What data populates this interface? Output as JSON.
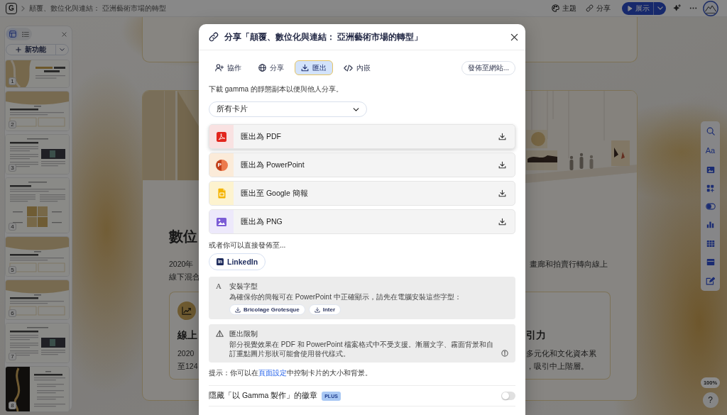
{
  "top_bar": {
    "logo": "G",
    "breadcrumb": "顛覆、數位化與連結： 亞洲藝術市場的轉型",
    "actions": [
      {
        "kind": "theme",
        "label": "主題"
      },
      {
        "kind": "share",
        "label": "分享"
      }
    ],
    "present_button": "展示"
  },
  "sidebar": {
    "view_toggle": [
      {
        "kind": "grid",
        "selected": true
      },
      {
        "kind": "list",
        "selected": false
      }
    ],
    "new_button": "新功能",
    "thumbnails": [
      {
        "number": "1",
        "kind": "title"
      },
      {
        "number": "2",
        "kind": "banner"
      },
      {
        "number": "3",
        "kind": "image_right"
      },
      {
        "number": "4",
        "kind": "grid"
      },
      {
        "number": "5",
        "kind": "banner"
      },
      {
        "number": "6",
        "kind": "banner"
      },
      {
        "number": "7",
        "kind": "image_right"
      },
      {
        "number": "8",
        "kind": "image_left"
      }
    ]
  },
  "canvas": {
    "heading": "數位",
    "paragraph_left": [
      "2020年",
      "線下混合"
    ],
    "paragraph_right": "畫廊和拍賣行轉向線上",
    "cards": [
      {
        "title": "線上",
        "lines": [
          "2020",
          "至124"
        ]
      },
      {
        "title": "引力",
        "lines": [
          "多元化和文化資本累",
          "，吸引中上階層。"
        ]
      }
    ]
  },
  "toolbar": [
    {
      "kind": "search"
    },
    {
      "kind": "text",
      "glyph": "Aa"
    },
    {
      "kind": "image"
    },
    {
      "kind": "blocks"
    },
    {
      "kind": "toggle"
    },
    {
      "kind": "chart"
    },
    {
      "kind": "table"
    },
    {
      "kind": "layout"
    },
    {
      "kind": "edit"
    }
  ],
  "zoom_level": "100%",
  "help": "?",
  "dialog": {
    "title": "分享「顛覆、數位化與連結： 亞洲藝術市場的轉型」",
    "tabs": [
      {
        "kind": "collaborate",
        "label": "協作",
        "selected": false
      },
      {
        "kind": "share",
        "label": "分享",
        "selected": false
      },
      {
        "kind": "export",
        "label": "匯出",
        "selected": true
      },
      {
        "kind": "embed",
        "label": "內嵌",
        "selected": false
      }
    ],
    "publish_button": "發佈至網站...",
    "description": "下載 gamma 的靜態副本以便與他人分享。",
    "card_select": {
      "value": "所有卡片"
    },
    "export_options": [
      {
        "kind": "pdf",
        "label": "匯出為 PDF",
        "hovered": true
      },
      {
        "kind": "powerpoint",
        "label": "匯出為 PowerPoint",
        "logo": "P",
        "hovered": false
      },
      {
        "kind": "google_slides",
        "label": "匯出至 Google 簡報",
        "hovered": false
      },
      {
        "kind": "png",
        "label": "匯出為 PNG",
        "hovered": false
      }
    ],
    "publish_label": "或者你可以直接發佈至...",
    "publish_targets": [
      {
        "label": "LinkedIn",
        "logo": "in"
      }
    ],
    "font_notice": {
      "icon": "A",
      "title": "安裝字型",
      "text": "為確保你的簡報可在 PowerPoint 中正確顯示，請先在電腦安裝這些字型：",
      "fonts": [
        "Bricolage Grotesque",
        "Inter"
      ]
    },
    "export_warning": {
      "title": "匯出限制",
      "text": "部分視覺效果在 PDF 和 PowerPoint 檔案格式中不受支援。漸層文字、霧面背景和自訂重點圖片形狀可能會使用替代樣式。"
    },
    "hint": {
      "before": "提示：你可以在",
      "link": "頁面設定",
      "after": "中控制卡片的大小和背景。"
    },
    "badge_setting": {
      "label": "隱藏「以 Gamma 製作」的徽章",
      "badge": "PLUS",
      "on": false
    }
  }
}
